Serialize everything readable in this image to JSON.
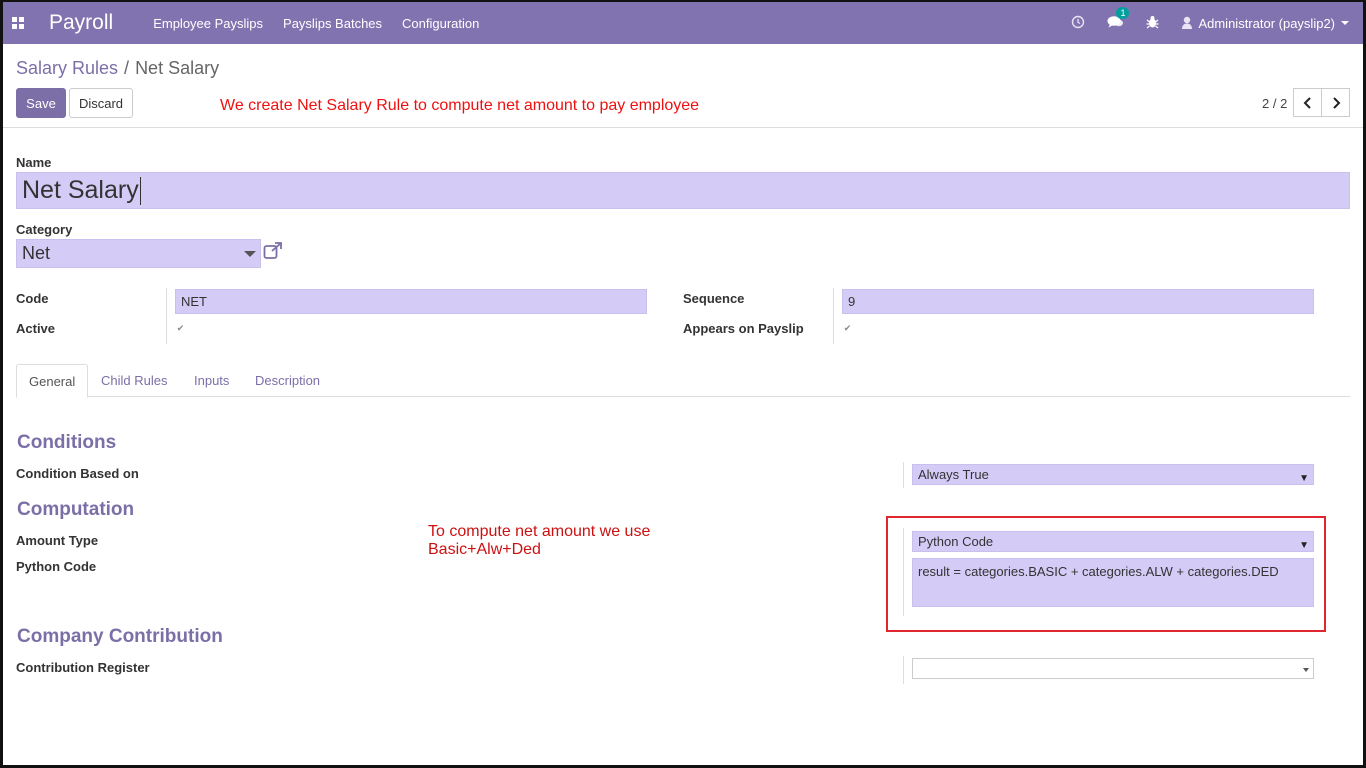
{
  "navbar": {
    "brand": "Payroll",
    "menu": [
      "Employee Payslips",
      "Payslips Batches",
      "Configuration"
    ],
    "messages_badge": "1",
    "user": "Administrator (payslip2)"
  },
  "breadcrumb": {
    "parent": "Salary Rules",
    "separator": "/",
    "current": "Net Salary"
  },
  "buttons": {
    "save": "Save",
    "discard": "Discard"
  },
  "annotations": {
    "top": "We create Net Salary Rule to compute net amount to pay employee",
    "middle_line1": "To compute net amount we use",
    "middle_line2": "Basic+Alw+Ded"
  },
  "pager": {
    "value": "2 / 2"
  },
  "form": {
    "name_label": "Name",
    "name_value": "Net Salary",
    "category_label": "Category",
    "category_value": "Net",
    "code_label": "Code",
    "code_value": "NET",
    "active_label": "Active",
    "sequence_label": "Sequence",
    "sequence_value": "9",
    "appears_label": "Appears on Payslip"
  },
  "tabs": [
    "General",
    "Child Rules",
    "Inputs",
    "Description"
  ],
  "general": {
    "conditions_title": "Conditions",
    "condition_based_label": "Condition Based on",
    "condition_based_value": "Always True",
    "computation_title": "Computation",
    "amount_type_label": "Amount Type",
    "amount_type_value": "Python Code",
    "python_code_label": "Python Code",
    "python_code_value": "result = categories.BASIC + categories.ALW + categories.DED",
    "company_contribution_title": "Company Contribution",
    "contribution_register_label": "Contribution Register",
    "contribution_register_value": ""
  },
  "colors": {
    "navbar": "#8173b0",
    "accent": "#7c6fa8",
    "input_bg": "#d4ccf7",
    "annotation": "#e11111"
  }
}
